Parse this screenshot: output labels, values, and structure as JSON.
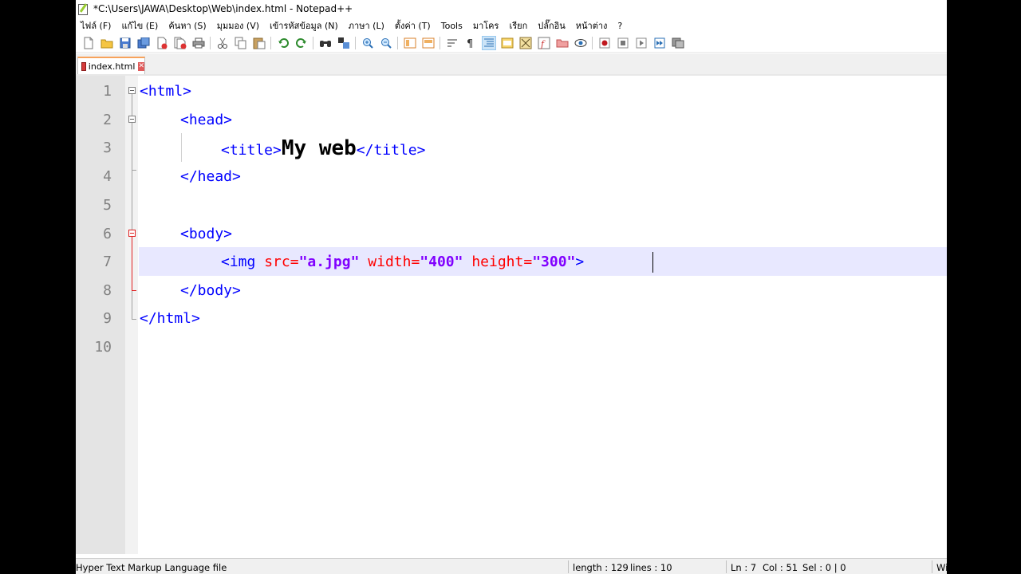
{
  "window": {
    "title": "*C:\\Users\\JAWA\\Desktop\\Web\\index.html - Notepad++"
  },
  "menu": [
    "ไฟล์ (F)",
    "แก้ไข (E)",
    "ค้นหา (S)",
    "มุมมอง (V)",
    "เข้ารหัสข้อมูล (N)",
    "ภาษา (L)",
    "ตั้งค่า (T)",
    "Tools",
    "มาโคร",
    "เรียก",
    "ปลั๊กอิน",
    "หน้าต่าง",
    "?"
  ],
  "toolbar_icons": [
    "new-file-icon",
    "open-file-icon",
    "save-icon",
    "save-all-icon",
    "close-icon",
    "close-all-icon",
    "print-icon",
    "cut-icon",
    "copy-icon",
    "paste-icon",
    "undo-icon",
    "redo-icon",
    "find-icon",
    "replace-icon",
    "zoom-in-icon",
    "zoom-out-icon",
    "sync-vertical-icon",
    "sync-horizontal-icon",
    "word-wrap-icon",
    "show-all-chars-icon",
    "indent-guide-icon",
    "user-defined-lang-icon",
    "doc-map-icon",
    "function-list-icon",
    "folder-workspace-icon",
    "monitoring-icon",
    "record-macro-icon",
    "stop-macro-icon",
    "play-macro-icon",
    "run-macro-multiple-icon",
    "save-macro-icon"
  ],
  "tab": {
    "label": "index.html",
    "close": "✕"
  },
  "editor": {
    "lines": [
      {
        "num": "1",
        "tag_open": "<html>"
      },
      {
        "num": "2",
        "tag_open": "<head>"
      },
      {
        "num": "3",
        "tag_open": "<title>",
        "text": "My web",
        "tag_close": "</title>"
      },
      {
        "num": "4",
        "tag_open": "</head>"
      },
      {
        "num": "5"
      },
      {
        "num": "6",
        "tag_open": "<body>"
      },
      {
        "num": "7",
        "img_tag": "<img",
        "src_attr": "src=",
        "src_val": "\"a.jpg\"",
        "width_attr": "width=",
        "width_val": "\"400\"",
        "height_attr": "height=",
        "height_val": "\"300\"",
        "end": ">"
      },
      {
        "num": "8",
        "tag_open": "</body>"
      },
      {
        "num": "9",
        "tag_open": "</html>"
      },
      {
        "num": "10"
      }
    ],
    "current_line": 7
  },
  "status": {
    "file_type": "Hyper Text Markup Language file",
    "length": "length : 129",
    "lines": "lines : 10",
    "ln": "Ln : 7",
    "col": "Col : 51",
    "sel": "Sel : 0 | 0",
    "eol": "Wi"
  },
  "colors": {
    "tag": "#0000ff",
    "attr": "#ff0000",
    "value": "#8000ff",
    "current_line_bg": "#e8e8ff"
  }
}
